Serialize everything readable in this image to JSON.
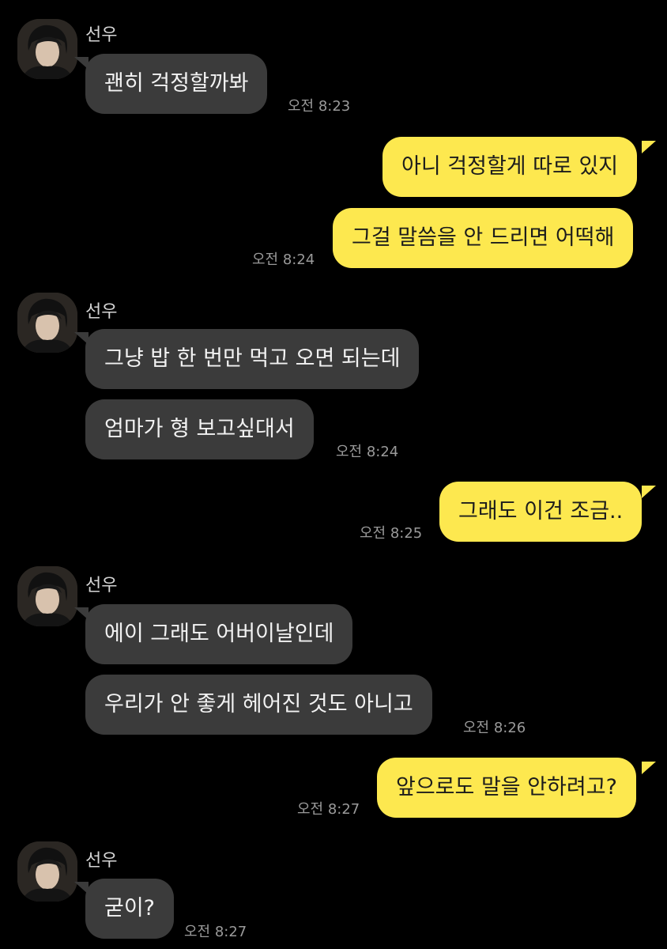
{
  "contact": {
    "name": "선우"
  },
  "messages": [
    {
      "from": "contact",
      "text": "괜히 걱정할까봐",
      "time": "오전 8:23"
    },
    {
      "from": "me",
      "text": "아니 걱정할게 따로 있지"
    },
    {
      "from": "me",
      "text": "그걸 말씀을 안 드리면 어떡해",
      "time": "오전 8:24"
    },
    {
      "from": "contact",
      "text": "그냥 밥 한 번만 먹고 오면 되는데"
    },
    {
      "from": "contact",
      "text": "엄마가 형 보고싶대서",
      "time": "오전 8:24"
    },
    {
      "from": "me",
      "text": "그래도 이건 조금..",
      "time": "오전 8:25"
    },
    {
      "from": "contact",
      "text": "에이 그래도 어버이날인데"
    },
    {
      "from": "contact",
      "text": "우리가 안 좋게 헤어진 것도 아니고",
      "time": "오전 8:26"
    },
    {
      "from": "me",
      "text": "앞으로도 말을 안하려고?",
      "time": "오전 8:27"
    },
    {
      "from": "contact",
      "text": "굳이?",
      "time": "오전 8:27"
    }
  ],
  "colors": {
    "background": "#000000",
    "received_bubble": "#3b3b3b",
    "sent_bubble": "#fde84f",
    "timestamp": "#9a9a9a"
  },
  "icons": {
    "avatar": "profile-photo-avatar"
  }
}
